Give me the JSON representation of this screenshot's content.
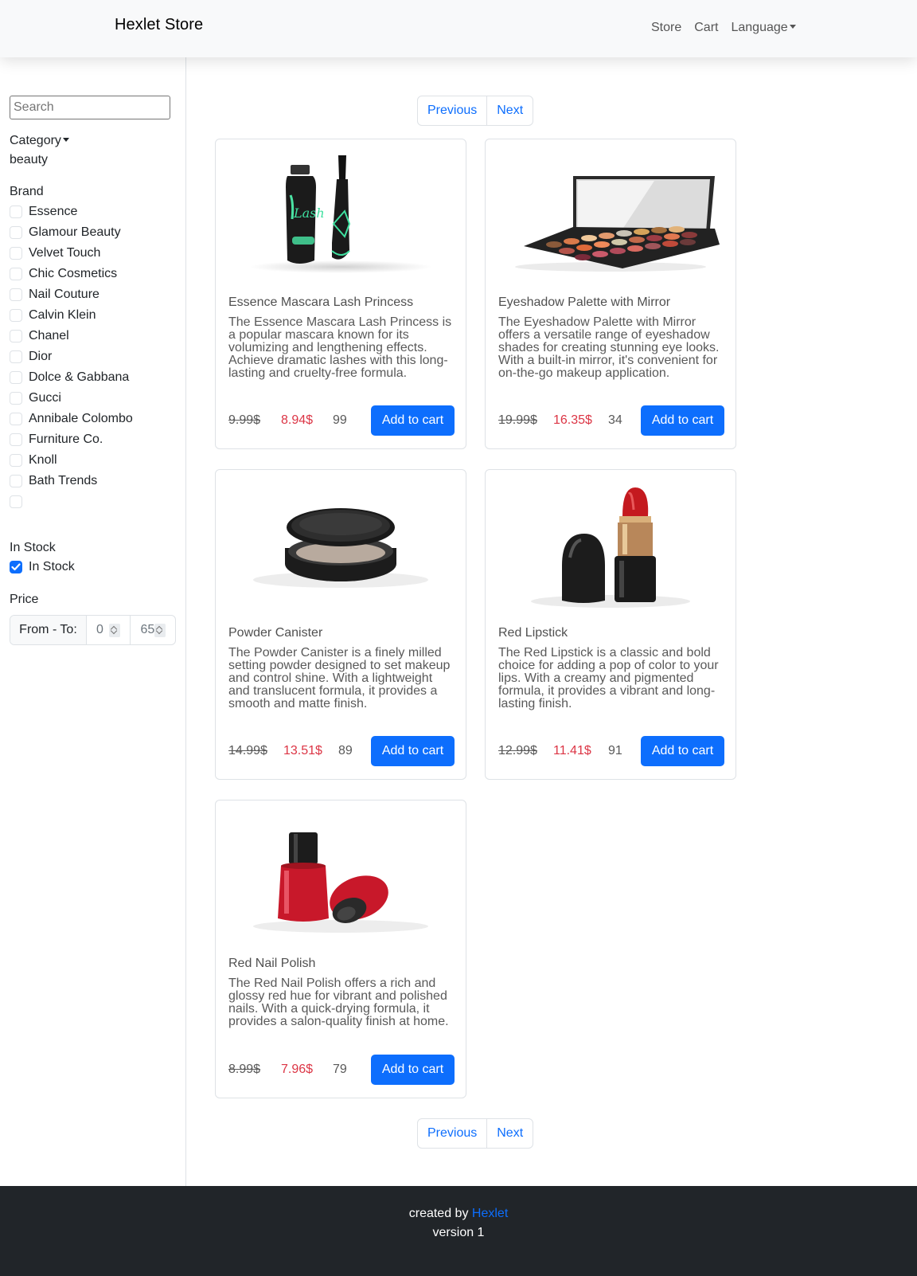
{
  "navbar": {
    "brand": "Hexlet Store",
    "links": {
      "store": "Store",
      "cart": "Cart",
      "language": "Language"
    }
  },
  "filters": {
    "search_placeholder": "Search",
    "category_label": "Category",
    "category_value": "beauty",
    "brand_label": "Brand",
    "brands": [
      "Essence",
      "Glamour Beauty",
      "Velvet Touch",
      "Chic Cosmetics",
      "Nail Couture",
      "Calvin Klein",
      "Chanel",
      "Dior",
      "Dolce & Gabbana",
      "Gucci",
      "Annibale Colombo",
      "Furniture Co.",
      "Knoll",
      "Bath Trends",
      ""
    ],
    "in_stock_label": "In Stock",
    "in_stock_option": "In Stock",
    "in_stock_checked": true,
    "price_label": "Price",
    "price_range_label": "From - To:",
    "price_from": "0",
    "price_to": "65"
  },
  "pagination": {
    "previous": "Previous",
    "next": "Next"
  },
  "products": [
    {
      "title": "Essence Mascara Lash Princess",
      "description": "The Essence Mascara Lash Princess is a popular mascara known for its volumizing and lengthening effects. Achieve dramatic lashes with this long-lasting and cruelty-free formula.",
      "old_price": "9.99$",
      "new_price": "8.94$",
      "stock": "99",
      "button": "Add to cart",
      "image": "mascara-image"
    },
    {
      "title": "Eyeshadow Palette with Mirror",
      "description": "The Eyeshadow Palette with Mirror offers a versatile range of eyeshadow shades for creating stunning eye looks. With a built-in mirror, it's convenient for on-the-go makeup application.",
      "old_price": "19.99$",
      "new_price": "16.35$",
      "stock": "34",
      "button": "Add to cart",
      "image": "eyeshadow-palette-image"
    },
    {
      "title": "Powder Canister",
      "description": "The Powder Canister is a finely milled setting powder designed to set makeup and control shine. With a lightweight and translucent formula, it provides a smooth and matte finish.",
      "old_price": "14.99$",
      "new_price": "13.51$",
      "stock": "89",
      "button": "Add to cart",
      "image": "powder-canister-image"
    },
    {
      "title": "Red Lipstick",
      "description": "The Red Lipstick is a classic and bold choice for adding a pop of color to your lips. With a creamy and pigmented formula, it provides a vibrant and long-lasting finish.",
      "old_price": "12.99$",
      "new_price": "11.41$",
      "stock": "91",
      "button": "Add to cart",
      "image": "lipstick-image"
    },
    {
      "title": "Red Nail Polish",
      "description": "The Red Nail Polish offers a rich and glossy red hue for vibrant and polished nails. With a quick-drying formula, it provides a salon-quality finish at home.",
      "old_price": "8.99$",
      "new_price": "7.96$",
      "stock": "79",
      "button": "Add to cart",
      "image": "nail-polish-image"
    }
  ],
  "footer": {
    "created_by": "created by",
    "link": "Hexlet",
    "version": "version 1"
  },
  "colors": {
    "primary": "#0d6efd",
    "sale": "#dc3545",
    "footer_bg": "#212529",
    "navbar_bg": "#f8f9fa"
  }
}
